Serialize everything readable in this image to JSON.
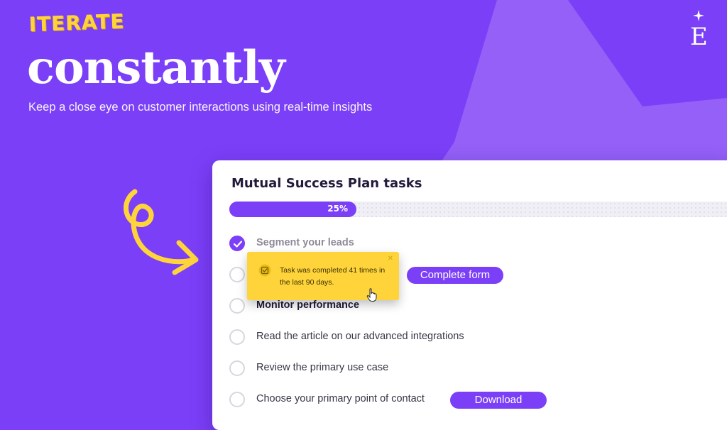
{
  "hero": {
    "eyebrow": "ITERATE",
    "headline": "constantly",
    "subtitle": "Keep a close eye on customer interactions using real-time insights"
  },
  "logo": {
    "letter": "E",
    "icon": "sparkle-icon"
  },
  "card": {
    "title": "Mutual Success Plan tasks",
    "progress": {
      "label": "25%",
      "percent": 25
    },
    "tasks": [
      {
        "label": "Segment your leads",
        "completed": true
      },
      {
        "label": "",
        "completed": false,
        "action": "Complete form"
      },
      {
        "label": "Monitor performance",
        "completed": false
      },
      {
        "label": "Read the article on our advanced integrations",
        "completed": false
      },
      {
        "label": "Review the primary use case",
        "completed": false
      },
      {
        "label": "Choose your primary point of contact",
        "completed": false,
        "action": "Download"
      }
    ]
  },
  "tooltip": {
    "text": "Task was completed 41 times in the last 90 days.",
    "icon": "checkbox-icon",
    "close_icon": "close-icon"
  },
  "colors": {
    "background": "#7B3FF7",
    "accent_shape": "#9460F8",
    "highlight": "#FFD43B",
    "card": "#FFFFFF",
    "text_dark": "#231A3A"
  }
}
